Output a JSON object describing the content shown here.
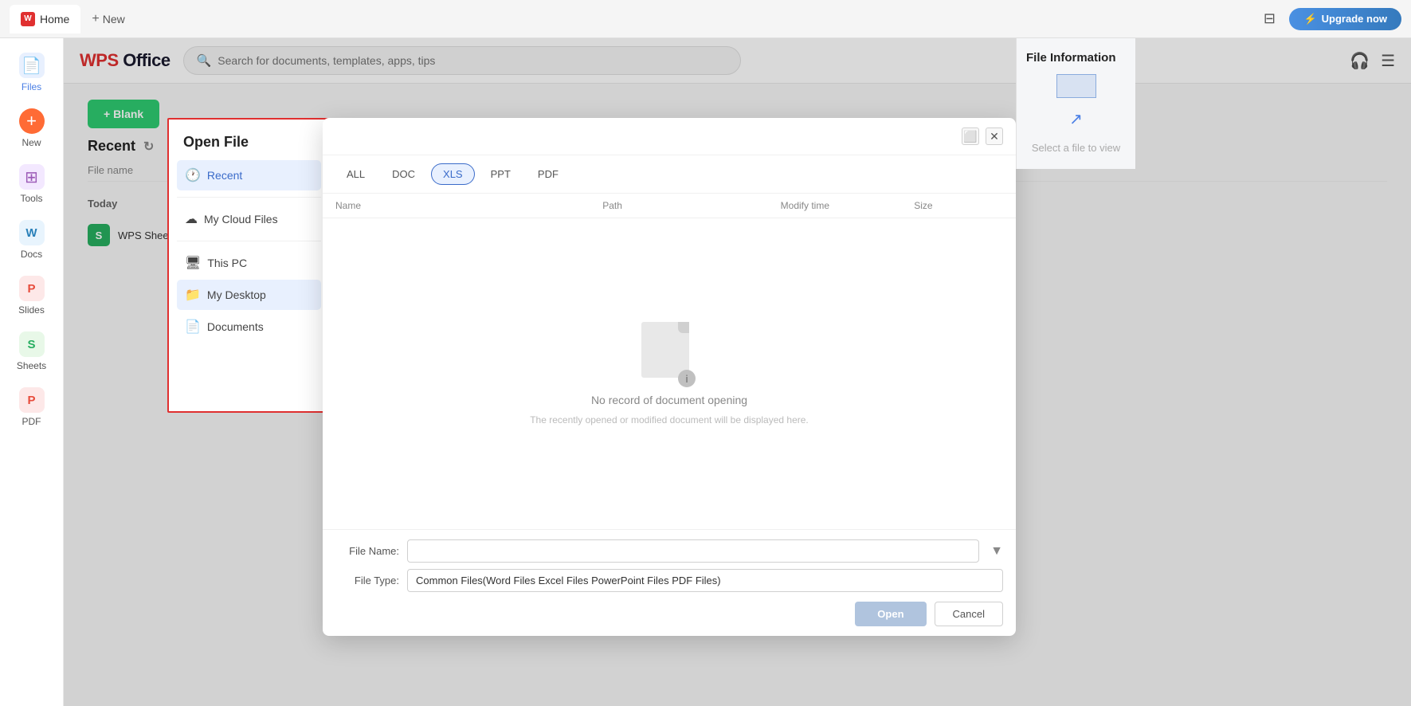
{
  "titlebar": {
    "home_label": "Home",
    "new_label": "New",
    "upgrade_label": "Upgrade now"
  },
  "topbar": {
    "logo": "WPS Office",
    "search_placeholder": "Search for documents, templates, apps, tips"
  },
  "sidebar": {
    "items": [
      {
        "id": "files",
        "label": "Files",
        "icon": "📄"
      },
      {
        "id": "new",
        "label": "New",
        "icon": "+"
      },
      {
        "id": "tools",
        "label": "Tools",
        "icon": "⊞"
      },
      {
        "id": "docs",
        "label": "Docs",
        "icon": "W"
      },
      {
        "id": "slides",
        "label": "Slides",
        "icon": "P"
      },
      {
        "id": "sheets",
        "label": "Sheets",
        "icon": "S"
      },
      {
        "id": "pdf",
        "label": "PDF",
        "icon": "P"
      }
    ]
  },
  "recent": {
    "title": "Recent",
    "blank_button": "+ Blank",
    "filename_header": "File name",
    "today_label": "Today",
    "file_item": "WPS Sheets Quick Sta..."
  },
  "open_file_panel": {
    "title": "Open File",
    "nav_items": [
      {
        "id": "recent",
        "label": "Recent",
        "icon": "🕐",
        "active": true
      },
      {
        "id": "cloud",
        "label": "My Cloud Files",
        "icon": "☁"
      },
      {
        "id": "this_pc",
        "label": "This PC",
        "icon": "💻"
      },
      {
        "id": "desktop",
        "label": "My Desktop",
        "icon": "📁",
        "active_hover": true
      },
      {
        "id": "documents",
        "label": "Documents",
        "icon": "📄"
      }
    ]
  },
  "open_file_dialog": {
    "type_tabs": [
      {
        "id": "all",
        "label": "ALL"
      },
      {
        "id": "doc",
        "label": "DOC"
      },
      {
        "id": "xls",
        "label": "XLS",
        "active": true
      },
      {
        "id": "ppt",
        "label": "PPT"
      },
      {
        "id": "pdf",
        "label": "PDF"
      }
    ],
    "columns": [
      "Name",
      "Path",
      "Modify time",
      "Size"
    ],
    "empty_main": "No record of document opening",
    "empty_sub": "The recently opened or modified document will be displayed here.",
    "file_name_label": "File Name:",
    "file_type_label": "File Type:",
    "file_type_value": "Common Files(Word Files Excel Files PowerPoint Files PDF Files)",
    "open_btn": "Open",
    "cancel_btn": "Cancel"
  },
  "file_info": {
    "title": "File Information",
    "select_text": "Select a file to view"
  }
}
